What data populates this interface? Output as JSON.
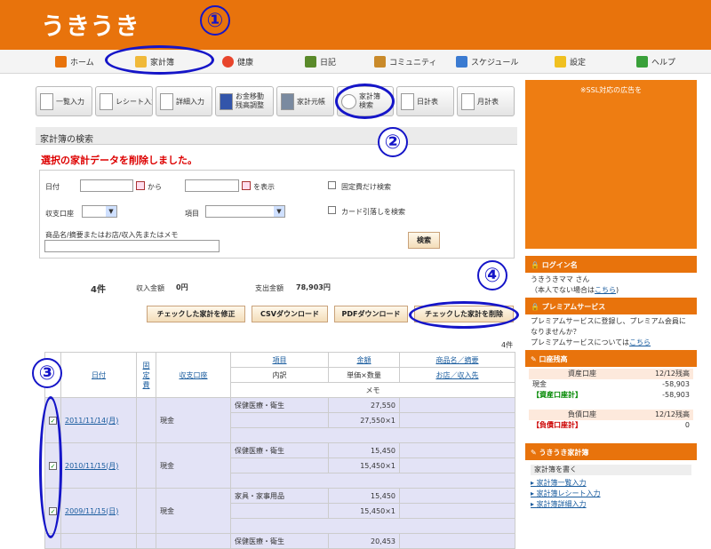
{
  "header": {
    "logo": "うきうき"
  },
  "nav": [
    "ホーム",
    "家計簿",
    "健康",
    "日記",
    "コミュニティ",
    "スケジュール",
    "設定",
    "ヘルプ"
  ],
  "toolbar": [
    "一覧入力",
    "レシート入力",
    "詳細入力",
    "お金移動\n残高調整",
    "家計元帳",
    "家計簿\n検索",
    "日計表",
    "月計表"
  ],
  "annotations": [
    "①",
    "②",
    "③",
    "④"
  ],
  "search": {
    "title": "家計簿の検索",
    "message": "選択の家計データを削除しました。",
    "date_label": "日付",
    "from": "から",
    "to": "を表示",
    "fixed_only": "固定費だけ検索",
    "account_label": "収支口座",
    "item_label": "項目",
    "card_only": "カード引落しを検索",
    "keyword_label": "商品名/摘要またはお店/収入先またはメモ",
    "search_button": "検索"
  },
  "summary": {
    "count": "4件",
    "income_label": "収入金額",
    "income_value": "0円",
    "expense_label": "支出金額",
    "expense_value": "78,903円"
  },
  "actions": [
    "チェックした家計を修正",
    "CSVダウンロード",
    "PDFダウンロード",
    "チェックした家計を削除"
  ],
  "table": {
    "count": "4件",
    "headers": {
      "date": "日付",
      "fixed": "固定費",
      "account": "収支口座",
      "item": "項目",
      "amount": "金額",
      "product": "商品名／摘要",
      "breakdown": "内訳",
      "unit": "単価×数量",
      "shop": "お店／収入先",
      "memo": "メモ"
    },
    "rows": [
      {
        "date": "2011/11/14(月)",
        "account": "現金",
        "item": "保健医療・衛生",
        "amount": "27,550",
        "unit": "27,550×1"
      },
      {
        "date": "2010/11/15(月)",
        "account": "現金",
        "item": "保健医療・衛生",
        "amount": "15,450",
        "unit": "15,450×1"
      },
      {
        "date": "2009/11/15(日)",
        "account": "現金",
        "item": "家具・家事用品",
        "amount": "15,450",
        "unit": "15,450×1"
      },
      {
        "date": "",
        "account": "",
        "item": "保健医療・衛生",
        "amount": "20,453",
        "unit": ""
      }
    ]
  },
  "sidebar": {
    "ad": "※SSL対応の広告を",
    "login_title": "ログイン名",
    "login_user": "うきうきママ さん",
    "login_note": "（本人でない場合は",
    "login_link": "こちら",
    "login_close": ")",
    "premium_title": "プレミアムサービス",
    "premium_text": "プレミアムサービスに登録し、プレミアム会員になりませんか？",
    "premium_more": "プレミアムサービスについては",
    "premium_link": "こちら",
    "balance_title": "口座残高",
    "asset_head": "資産口座",
    "asset_date": "12/12残高",
    "cash": "現金",
    "cash_value": "-58,903",
    "asset_total": "【資産口座計】",
    "asset_total_value": "-58,903",
    "debt_head": "負債口座",
    "debt_date": "12/12残高",
    "debt_total": "【負債口座計】",
    "debt_total_value": "0",
    "kakeibo_title": "うきうき家計簿",
    "write_head": "家計簿を書く",
    "links": [
      "家計簿一覧入力",
      "家計簿レシート入力",
      "家計簿詳細入力"
    ]
  }
}
